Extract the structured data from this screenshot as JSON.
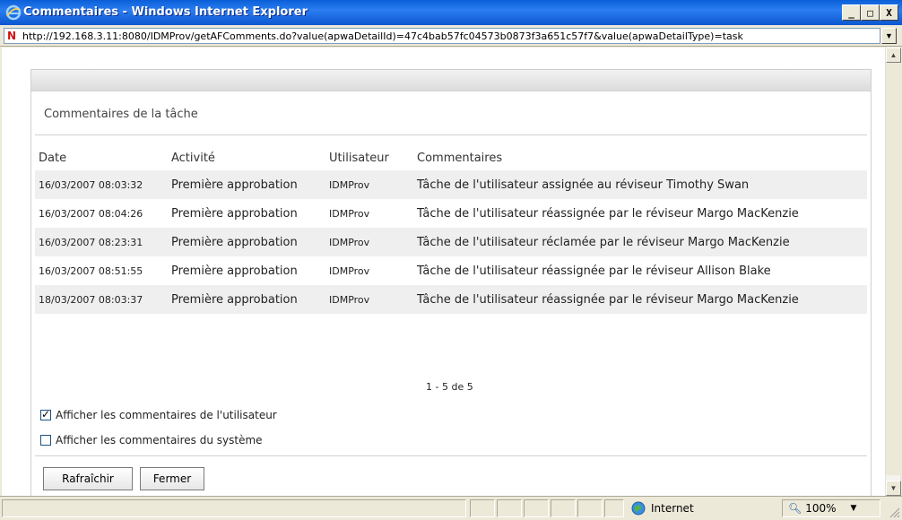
{
  "window": {
    "title": "Commentaires - Windows Internet Explorer",
    "icon": "ie-icon",
    "buttons": [
      "_",
      "□",
      "X"
    ]
  },
  "address": {
    "url": "http://192.168.3.11:8080/IDMProv/getAFComments.do?value(apwaDetailId)=47c4bab57fc04573b0873f3a651c57f7&value(apwaDetailType)=task"
  },
  "panel": {
    "title": "Commentaires de la tâche",
    "columns": [
      "Date",
      "Activité",
      "Utilisateur",
      "Commentaires"
    ],
    "rows": [
      {
        "date": "16/03/2007 08:03:32",
        "activity": "Première approbation",
        "user": "IDMProv",
        "comment": "Tâche de l'utilisateur assignée au réviseur Timothy Swan"
      },
      {
        "date": "16/03/2007 08:04:26",
        "activity": "Première approbation",
        "user": "IDMProv",
        "comment": "Tâche de l'utilisateur réassignée par le réviseur Margo MacKenzie"
      },
      {
        "date": "16/03/2007 08:23:31",
        "activity": "Première approbation",
        "user": "IDMProv",
        "comment": "Tâche de l'utilisateur réclamée par le réviseur Margo MacKenzie"
      },
      {
        "date": "16/03/2007 08:51:55",
        "activity": "Première approbation",
        "user": "IDMProv",
        "comment": "Tâche de l'utilisateur réassignée par le réviseur Allison Blake"
      },
      {
        "date": "18/03/2007 08:03:37",
        "activity": "Première approbation",
        "user": "IDMProv",
        "comment": "Tâche de l'utilisateur réassignée par le réviseur Margo MacKenzie"
      }
    ],
    "pager": "1 - 5 de 5",
    "show_user_comments": {
      "label": "Afficher les commentaires de l'utilisateur",
      "checked": true
    },
    "show_system_comments": {
      "label": "Afficher les commentaires du système",
      "checked": false
    },
    "refresh_label": "Rafraîchir",
    "close_label": "Fermer"
  },
  "status": {
    "zone": "Internet",
    "zoom": "100%"
  },
  "colors": {
    "titlebar": "#0a5fd8",
    "row_alt": "#efefef",
    "chrome": "#ece9d8"
  }
}
